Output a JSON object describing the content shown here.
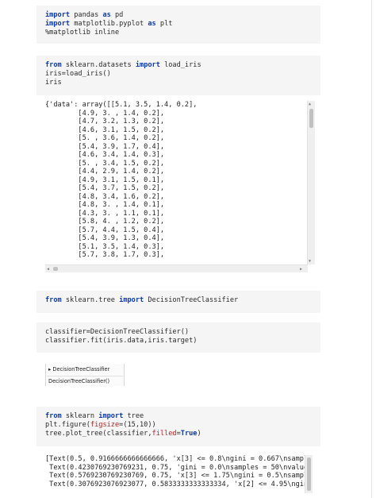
{
  "cell1": {
    "lines": [
      [
        {
          "t": "import",
          "c": "kw"
        },
        {
          "t": " pandas ",
          "c": "txt"
        },
        {
          "t": "as",
          "c": "kw"
        },
        {
          "t": " pd",
          "c": "txt"
        }
      ],
      [
        {
          "t": "import",
          "c": "kw"
        },
        {
          "t": " matplotlib.pyplot ",
          "c": "txt"
        },
        {
          "t": "as",
          "c": "kw"
        },
        {
          "t": " plt",
          "c": "txt"
        }
      ],
      [
        {
          "t": "%matplotlib inline",
          "c": "txt"
        }
      ]
    ]
  },
  "cell2": {
    "lines": [
      [
        {
          "t": "from",
          "c": "kw"
        },
        {
          "t": " sklearn.datasets ",
          "c": "txt"
        },
        {
          "t": "import",
          "c": "kw"
        },
        {
          "t": " load_iris",
          "c": "txt"
        }
      ],
      [
        {
          "t": "iris=load_iris()",
          "c": "txt"
        }
      ],
      [
        {
          "t": "iris",
          "c": "txt"
        }
      ]
    ]
  },
  "output1": {
    "lines": [
      "{'data': array([[5.1, 3.5, 1.4, 0.2],",
      "        [4.9, 3. , 1.4, 0.2],",
      "        [4.7, 3.2, 1.3, 0.2],",
      "        [4.6, 3.1, 1.5, 0.2],",
      "        [5. , 3.6, 1.4, 0.2],",
      "        [5.4, 3.9, 1.7, 0.4],",
      "        [4.6, 3.4, 1.4, 0.3],",
      "        [5. , 3.4, 1.5, 0.2],",
      "        [4.4, 2.9, 1.4, 0.2],",
      "        [4.9, 3.1, 1.5, 0.1],",
      "        [5.4, 3.7, 1.5, 0.2],",
      "        [4.8, 3.4, 1.6, 0.2],",
      "        [4.8, 3. , 1.4, 0.1],",
      "        [4.3, 3. , 1.1, 0.1],",
      "        [5.8, 4. , 1.2, 0.2],",
      "        [5.7, 4.4, 1.5, 0.4],",
      "        [5.4, 3.9, 1.3, 0.4],",
      "        [5.1, 3.5, 1.4, 0.3],",
      "        [5.7, 3.8, 1.7, 0.3],"
    ]
  },
  "cell3": {
    "lines": [
      [
        {
          "t": "from",
          "c": "kw"
        },
        {
          "t": " sklearn.tree ",
          "c": "txt"
        },
        {
          "t": "import",
          "c": "kw"
        },
        {
          "t": " DecisionTreeClassifier",
          "c": "txt"
        }
      ]
    ]
  },
  "cell4": {
    "lines": [
      [
        {
          "t": "classifier=DecisionTreeClassifier()",
          "c": "txt"
        }
      ],
      [
        {
          "t": "classifier.fit(iris.data,iris.target)",
          "c": "txt"
        }
      ]
    ]
  },
  "widget": {
    "header": "▸ DecisionTreeClassifier",
    "body": "DecisionTreeClassifier()"
  },
  "cell5": {
    "lines": [
      [
        {
          "t": "from",
          "c": "kw"
        },
        {
          "t": " sklearn ",
          "c": "txt"
        },
        {
          "t": "import",
          "c": "kw"
        },
        {
          "t": " tree",
          "c": "txt"
        }
      ],
      [
        {
          "t": "plt.figure(",
          "c": "txt"
        },
        {
          "t": "figsize",
          "c": "str"
        },
        {
          "t": "=(15,10))",
          "c": "txt"
        }
      ],
      [
        {
          "t": "tree.plot_tree(classifier,",
          "c": "txt"
        },
        {
          "t": "filled",
          "c": "str"
        },
        {
          "t": "=",
          "c": "txt"
        },
        {
          "t": "True",
          "c": "kw"
        },
        {
          "t": ")",
          "c": "txt"
        }
      ]
    ]
  },
  "output2": {
    "lines": [
      "[Text(0.5, 0.9166666666666666, 'x[3] <= 0.8\\ngini = 0.667\\nsamples",
      " Text(0.4230769230769231, 0.75, 'gini = 0.0\\nsamples = 50\\nvalue =",
      " Text(0.5769230769230769, 0.75, 'x[3] <= 1.75\\ngini = 0.5\\nsamples",
      " Text(0.3076923076923077, 0.5833333333333334, 'x[2] <= 4.95\\ngini ="
    ]
  },
  "scroll_arrows": {
    "up": "▲",
    "down": "▼",
    "left": "◀",
    "right": "▶"
  }
}
